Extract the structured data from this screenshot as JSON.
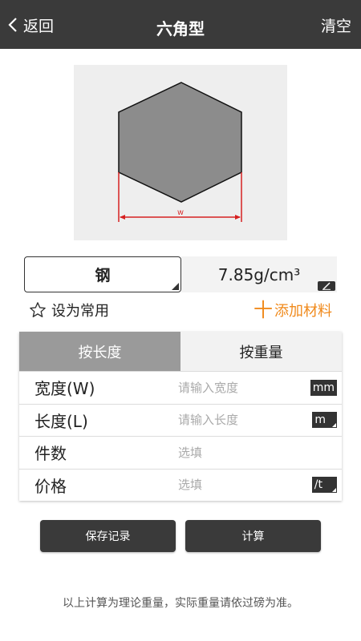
{
  "header": {
    "back_label": "返回",
    "title": "六角型",
    "clear_label": "清空"
  },
  "diagram": {
    "dimension_label": "w",
    "shape_fill": "#8c8c8c",
    "dimension_color": "#d62020"
  },
  "material": {
    "name": "钢",
    "density": "7.85g/cm³"
  },
  "favorite": {
    "label": "设为常用",
    "icon": "star-outline-icon"
  },
  "add_material": {
    "plus": "十",
    "label": "添加材料",
    "color": "#f08a1c"
  },
  "tabs": [
    {
      "label": "按长度",
      "active": true
    },
    {
      "label": "按重量",
      "active": false
    }
  ],
  "fields": [
    {
      "label": "宽度(W)",
      "placeholder": "请输入宽度",
      "unit": "mm"
    },
    {
      "label": "长度(L)",
      "placeholder": "请输入长度",
      "unit": "m"
    },
    {
      "label": "件数",
      "placeholder": "选填",
      "unit": ""
    },
    {
      "label": "价格",
      "placeholder": "选填",
      "unit": "/t"
    }
  ],
  "buttons": {
    "save": "保存记录",
    "calculate": "计算"
  },
  "note": "以上计算为理论重量，实际重量请依过磅为准。"
}
